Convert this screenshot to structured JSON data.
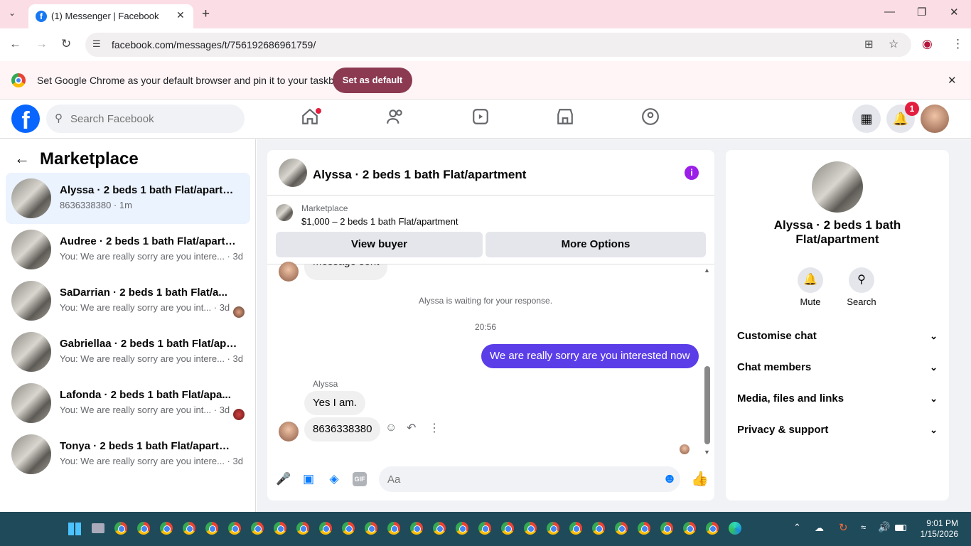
{
  "browser": {
    "tab_title": "(1) Messenger | Facebook",
    "url": "facebook.com/messages/t/756192686961759/",
    "infobar_text": "Set Google Chrome as your default browser and pin it to your taskbar",
    "set_default_label": "Set as default"
  },
  "fb": {
    "search_placeholder": "Search Facebook",
    "notification_count": "1"
  },
  "left": {
    "title": "Marketplace",
    "conversations": [
      {
        "name": "Alyssa · 2 beds 1 bath Flat/apartm...",
        "sub": "8636338380 · 1m"
      },
      {
        "name": "Audree · 2 beds 1 bath Flat/apartm...",
        "sub": "You: We are really sorry are you intere... · 3d"
      },
      {
        "name": "SaDarrian · 2 beds 1 bath Flat/a...",
        "sub": "You: We are really sorry are you int... · 3d"
      },
      {
        "name": "Gabriellaa · 2 beds 1 bath Flat/apar...",
        "sub": "You: We are really sorry are you intere... · 3d"
      },
      {
        "name": "Lafonda · 2 beds 1 bath Flat/apa...",
        "sub": "You: We are really sorry are you int... · 3d"
      },
      {
        "name": "Tonya · 2 beds 1 bath Flat/apartme...",
        "sub": "You: We are really sorry are you intere... · 3d"
      }
    ]
  },
  "chat": {
    "title": "Alyssa · 2 beds 1 bath Flat/apartment",
    "marketplace_label": "Marketplace",
    "listing": "$1,000 – 2 beds 1 bath Flat/apartment",
    "view_buyer": "View buyer",
    "more_options": "More Options",
    "partial_bubble": "Message sent",
    "waiting": "Alyssa is waiting for your response.",
    "time": "20:56",
    "outgoing": "We are really sorry are you interested now",
    "sender": "Alyssa",
    "msg1": "Yes I am.",
    "msg2": "8636338380",
    "input_placeholder": "Aa"
  },
  "right": {
    "name": "Alyssa · 2 beds 1 bath Flat/apartment",
    "mute": "Mute",
    "search": "Search",
    "sections": [
      "Customise chat",
      "Chat members",
      "Media, files and links",
      "Privacy & support"
    ]
  },
  "taskbar": {
    "time": "9:01 PM",
    "date": "1/15/2026"
  }
}
